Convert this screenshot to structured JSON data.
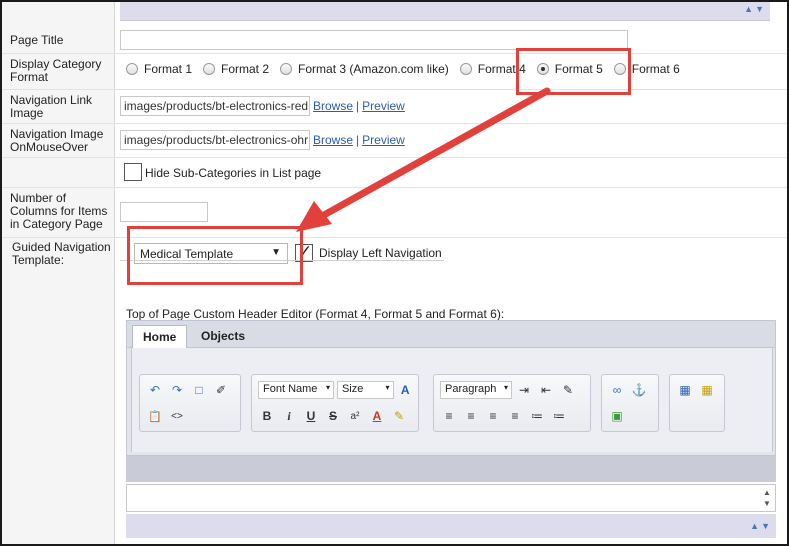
{
  "form": {
    "page_title": {
      "label": "Page Title",
      "value": ""
    },
    "display_category_format": {
      "label": "Display Category Format",
      "options": [
        "Format 1",
        "Format 2",
        "Format 3 (Amazon.com like)",
        "Format 4",
        "Format 5",
        "Format 6"
      ],
      "selected": "Format 5"
    },
    "nav_link_image": {
      "label": "Navigation Link Image",
      "value": "images/products/bt-electronics-red",
      "browse": "Browse",
      "preview": "Preview",
      "separator": "|"
    },
    "nav_image_mouseover": {
      "label": "Navigation Image OnMouseOver",
      "value": "images/products/bt-electronics-ohr",
      "browse": "Browse",
      "preview": "Preview",
      "separator": "|"
    },
    "hide_subcategories": {
      "label": "Hide Sub-Categories in List page",
      "checked": false
    },
    "columns_per_page": {
      "label": "Number of Columns for Items in Category Page",
      "value": ""
    },
    "guided_navigation": {
      "label": "Guided Navigation Template:",
      "selected": "Medical Template",
      "display_left_nav": {
        "label": "Display Left Navigation",
        "checked": true
      }
    }
  },
  "editor": {
    "title": "Top of Page Custom Header Editor (Format 4, Format 5 and Format 6):",
    "tabs": [
      "Home",
      "Objects"
    ],
    "active_tab": "Home",
    "font_name": "Font Name",
    "size": "Size",
    "paragraph": "Paragraph",
    "content": ""
  },
  "icons": {
    "undo": "↶",
    "redo": "↷",
    "select_all": "□",
    "eraser": "✐",
    "paste": "📋",
    "html": "<>",
    "bold": "B",
    "italic": "i",
    "underline": "U",
    "strike": "S",
    "superscript": "a²",
    "font_color": "A",
    "highlight": "✎",
    "text_color": "A",
    "indent": "⇥",
    "outdent": "⇤",
    "format_edit": "✎",
    "align_left": "≡",
    "align_center": "≡",
    "align_right": "≡",
    "justify": "≡",
    "ordered_list": "≔",
    "unordered_list": "≔",
    "link": "∞",
    "anchor": "⚓",
    "image": "▣",
    "table": "▦",
    "table_edit": "▦",
    "scroll_up": "▲",
    "scroll_down": "▼",
    "dropdown": "▼",
    "small_dropdown": "▾",
    "checkmark": "✓"
  },
  "colors": {
    "accent": "#e2413b",
    "link": "#2a5db0",
    "toolbar": "#e2e5ec"
  }
}
